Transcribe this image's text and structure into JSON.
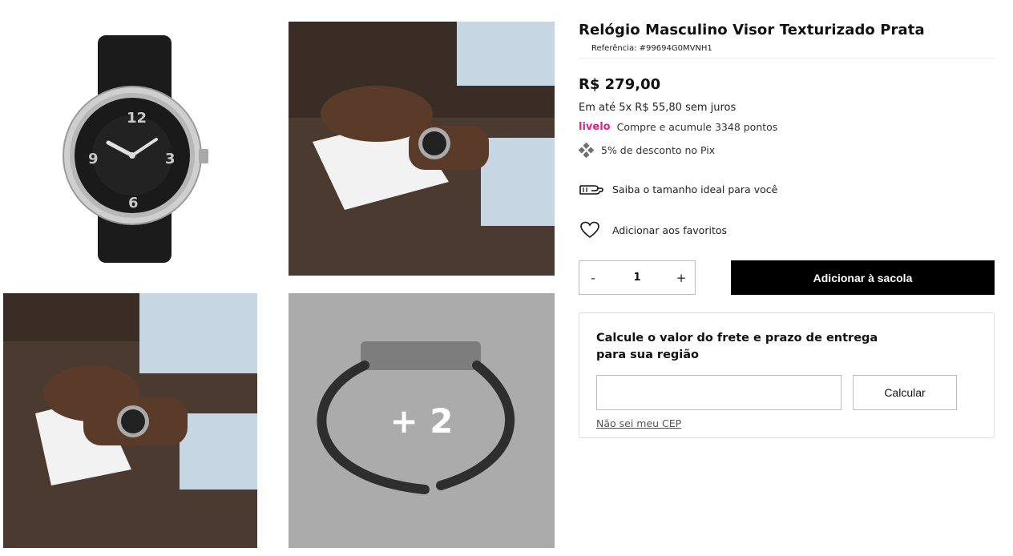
{
  "gallery": {
    "more_count_label": "+ 2"
  },
  "product": {
    "title": "Relógio Masculino Visor Texturizado Prata",
    "reference": "Referência: #99694G0MVNH1",
    "price": "R$ 279,00",
    "installments": "Em até 5x R$ 55,80 sem juros",
    "livelo_logo": "livelo",
    "livelo_text": "Compre e acumule 3348 pontos",
    "pix_text": "5% de desconto no Pix",
    "size_guide": "Saiba o tamanho ideal para você",
    "favorite": "Adicionar aos favoritos"
  },
  "purchase": {
    "minus": "-",
    "quantity": "1",
    "plus": "+",
    "add_to_bag": "Adicionar à sacola"
  },
  "shipping": {
    "title": "Calcule o valor do frete e prazo de entrega para sua região",
    "cep_value": "",
    "calculate": "Calcular",
    "no_cep_link": "Não sei meu CEP"
  },
  "icons": {
    "pix": "pix-icon",
    "size": "hand-measure-icon",
    "favorite": "heart-icon"
  },
  "colors": {
    "livelo": "#e0218a",
    "button_bg": "#000000",
    "overlay_bg": "#ababab"
  }
}
